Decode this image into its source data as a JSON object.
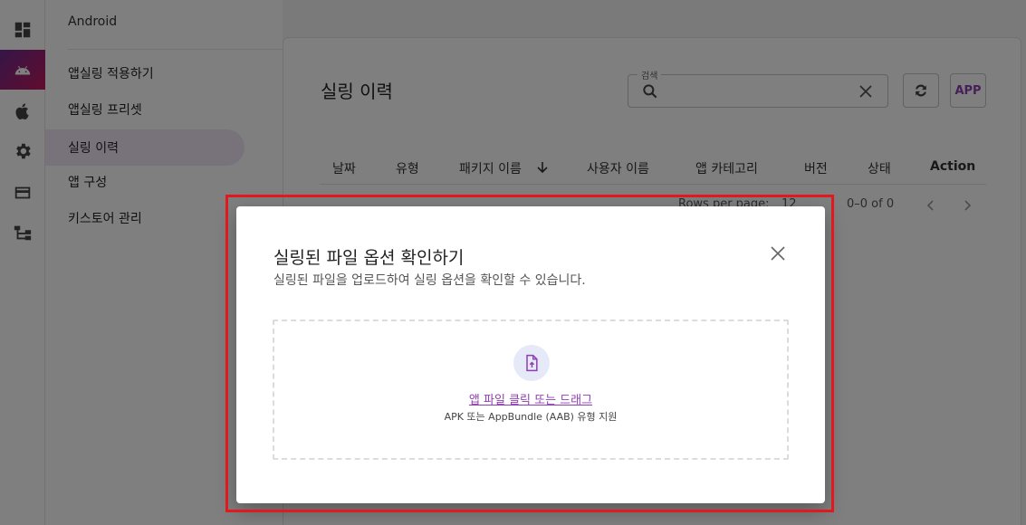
{
  "rail": {
    "items": [
      {
        "icon": "dashboard-icon"
      },
      {
        "icon": "android-icon",
        "active": true
      },
      {
        "icon": "apple-icon"
      },
      {
        "icon": "gear-icon"
      },
      {
        "icon": "card-icon"
      },
      {
        "icon": "hierarchy-icon"
      }
    ]
  },
  "nav": {
    "header": "Android",
    "items": [
      {
        "label": "앱실링 적용하기"
      },
      {
        "label": "앱실링 프리셋"
      },
      {
        "label": "실링 이력",
        "active": true
      },
      {
        "label": "앱 구성"
      },
      {
        "label": "키스토어 관리"
      }
    ]
  },
  "main": {
    "title": "실링 이력",
    "search": {
      "label": "검색",
      "value": ""
    },
    "app_button": "APP",
    "columns": [
      "날짜",
      "유형",
      "패키지 이름",
      "사용자 이름",
      "앱 카테고리",
      "버전",
      "상태",
      "Action"
    ],
    "pagination": {
      "rows_label": "Rows per page:",
      "rows_value": "12",
      "range": "0–0 of 0"
    }
  },
  "dialog": {
    "title": "실링된 파일 옵션 확인하기",
    "subtitle": "실링된 파일을 업로드하여 실링 옵션을 확인할 수 있습니다.",
    "upload_link": "앱 파일 클릭 또는 드래그",
    "upload_hint": "APK 또는 AppBundle (AAB) 유형 지원"
  },
  "colors": {
    "accent": "#8e3fb0",
    "highlight": "#e3181e",
    "rail_active_start": "#6a2c91",
    "rail_active_end": "#c2185b"
  }
}
